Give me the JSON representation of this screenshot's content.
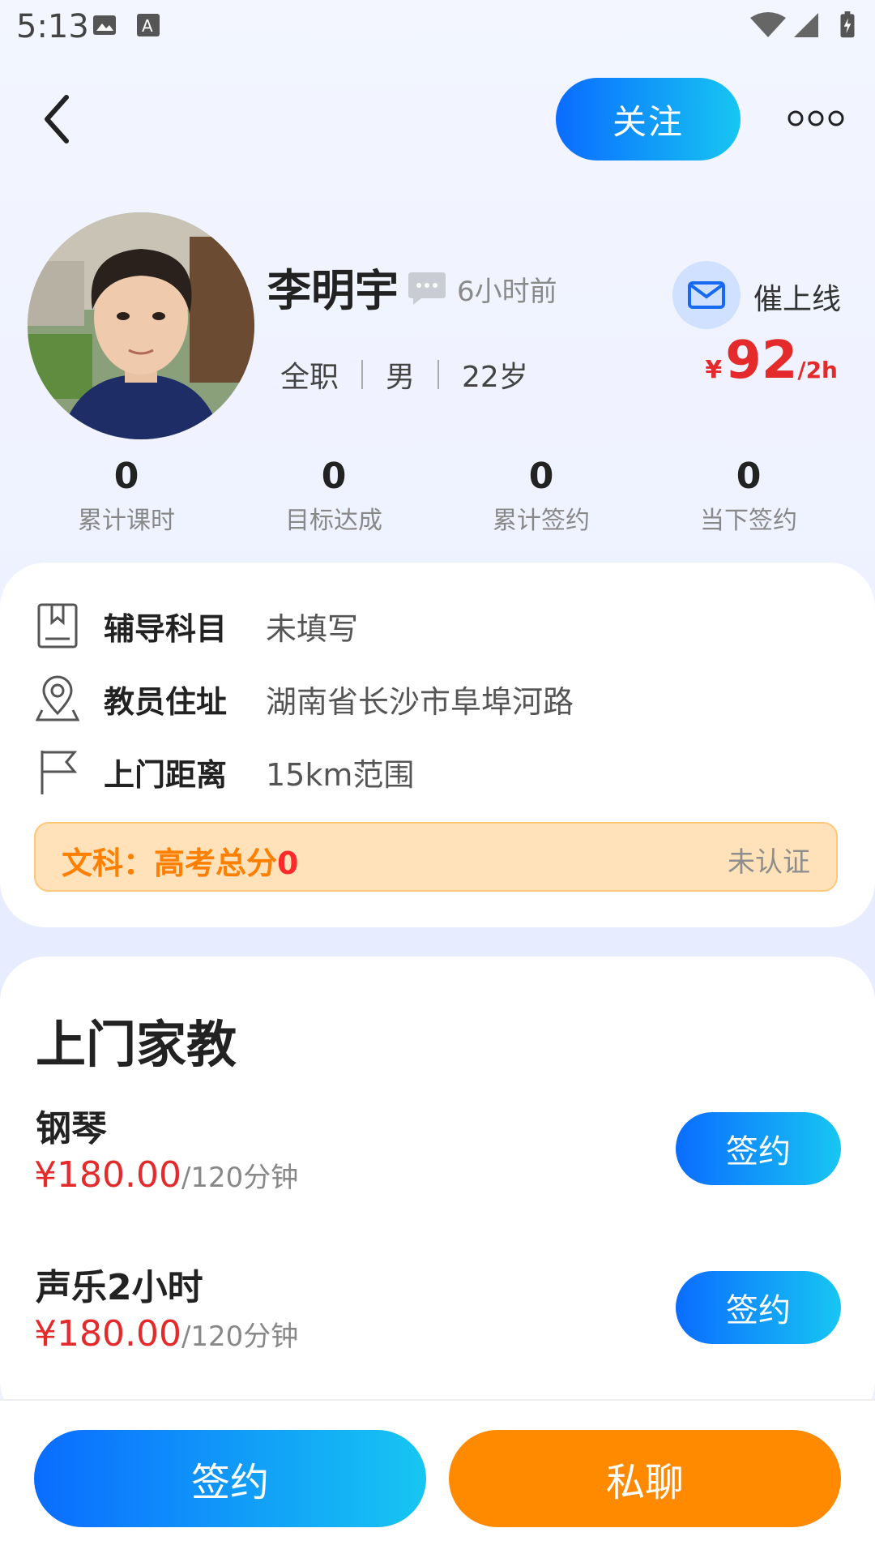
{
  "status_bar": {
    "time": "5:13"
  },
  "header": {
    "follow_label": "关注"
  },
  "profile": {
    "name": "李明宇",
    "last_seen": "6小时前",
    "job_type": "全职",
    "gender": "男",
    "age": "22岁",
    "remind_label": "催上线",
    "price_symbol": "¥",
    "price_value": "92",
    "price_unit": "/2h"
  },
  "stats": [
    {
      "value": "0",
      "label": "累计课时"
    },
    {
      "value": "0",
      "label": "目标达成"
    },
    {
      "value": "0",
      "label": "累计签约"
    },
    {
      "value": "0",
      "label": "当下签约"
    }
  ],
  "info": {
    "subject_key": "辅导科目",
    "subject_val": "未填写",
    "address_key": "教员住址",
    "address_val": "湖南省长沙市阜埠河路",
    "distance_key": "上门距离",
    "distance_val": "15km范围",
    "score_label": "文科：高考总分",
    "score_value": "0",
    "score_status": "未认证"
  },
  "services": {
    "title": "上门家教",
    "items": [
      {
        "name": "钢琴",
        "price": "¥180.00",
        "unit": "/120分钟",
        "button": "签约"
      },
      {
        "name": "声乐2小时",
        "price": "¥180.00",
        "unit": "/120分钟",
        "button": "签约"
      }
    ]
  },
  "bottom": {
    "sign_label": "签约",
    "chat_label": "私聊"
  },
  "colors": {
    "accent_blue": "#0a6cff",
    "accent_orange": "#ff8a00",
    "price_red": "#e42a2a"
  }
}
